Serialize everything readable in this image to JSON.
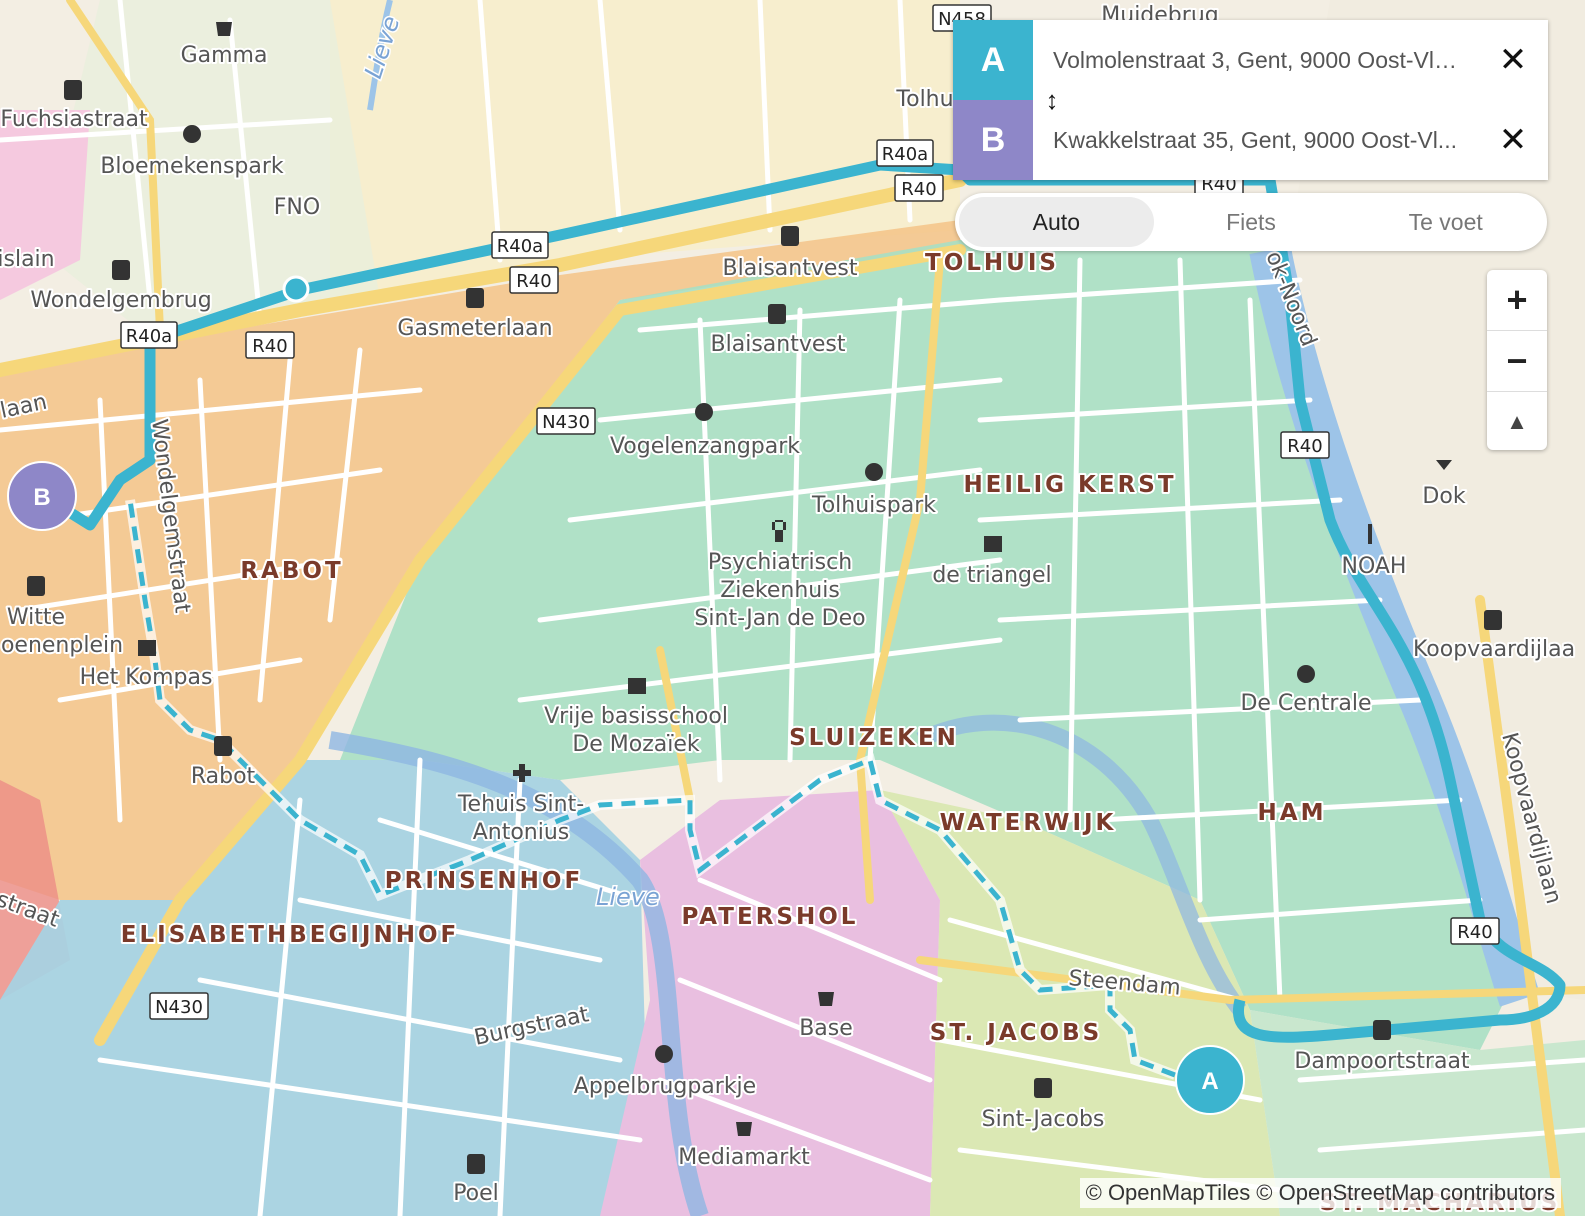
{
  "route": {
    "from": {
      "badge": "A",
      "value": "Volmolenstraat 3, Gent, 9000 Oost-Vl ...",
      "color": "#3bb4cf"
    },
    "to": {
      "badge": "B",
      "value": "Kwakkelstraat 35, Gent, 9000 Oost-Vl...",
      "color": "#8e87c8"
    },
    "clear_glyph": "✕",
    "swap_glyph": "↕"
  },
  "modes": [
    {
      "label": "Auto",
      "active": true
    },
    {
      "label": "Fiets",
      "active": false
    },
    {
      "label": "Te voet",
      "active": false
    }
  ],
  "zoom": {
    "in": "+",
    "out": "−",
    "compass": "▲"
  },
  "attribution": "© OpenMapTiles © OpenStreetMap contributors",
  "markers": {
    "start": "A",
    "end": "B"
  },
  "colors": {
    "route": "#3bb4cf",
    "walk": "#3bb4cf",
    "start": "#3bb4cf",
    "end": "#8e87c8"
  },
  "map": {
    "districts": [
      "RABOT",
      "TOLHUIS",
      "HEILIG KERST",
      "SLUIZEKEN",
      "WATERWIJK",
      "HAM",
      "PRINSENHOF",
      "PATERSHOL",
      "ELISABETHBEGIJNHOF",
      "ST. JACOBS",
      "ST. MACHARIUS"
    ],
    "places": [
      "Muidebrug",
      "Gamma",
      "Fuchsiastraat",
      "Bloemekenspark",
      "FNO",
      "Wondelgembrug",
      "Gasmeterlaan",
      "Blaisantvest",
      "Blaisantvest",
      "Vogelenzangpark",
      "Tolhuispark",
      "Psychiatrisch",
      "Ziekenhuis",
      "Sint-Jan de Deo",
      "de triangel",
      "Dok",
      "NOAH",
      "Koopvaardijlaa",
      "De Centrale",
      "Witte",
      "oenenplein",
      "Het Kompas",
      "Rabot",
      "Vrije basisschool",
      "De Mozaïek",
      "Tehuis Sint-",
      "Antonius",
      "Base",
      "Appelbrugparkje",
      "Mediamarkt",
      "Sint-Jacobs",
      "Dampoortstraat",
      "Poel",
      "Tolhu",
      "islain"
    ],
    "streets": [
      "Wondelgemstraat",
      "Burgstraat",
      "Steendam",
      "Koopvaardijlaan",
      "ok-Noord",
      "laan",
      "straat"
    ],
    "water": [
      "Lieve",
      "Lieve"
    ],
    "shields": [
      "N458",
      "R40a",
      "R40",
      "R40a",
      "R40",
      "R40a",
      "R40",
      "N430",
      "R40",
      "R40",
      "R40",
      "N430"
    ]
  }
}
